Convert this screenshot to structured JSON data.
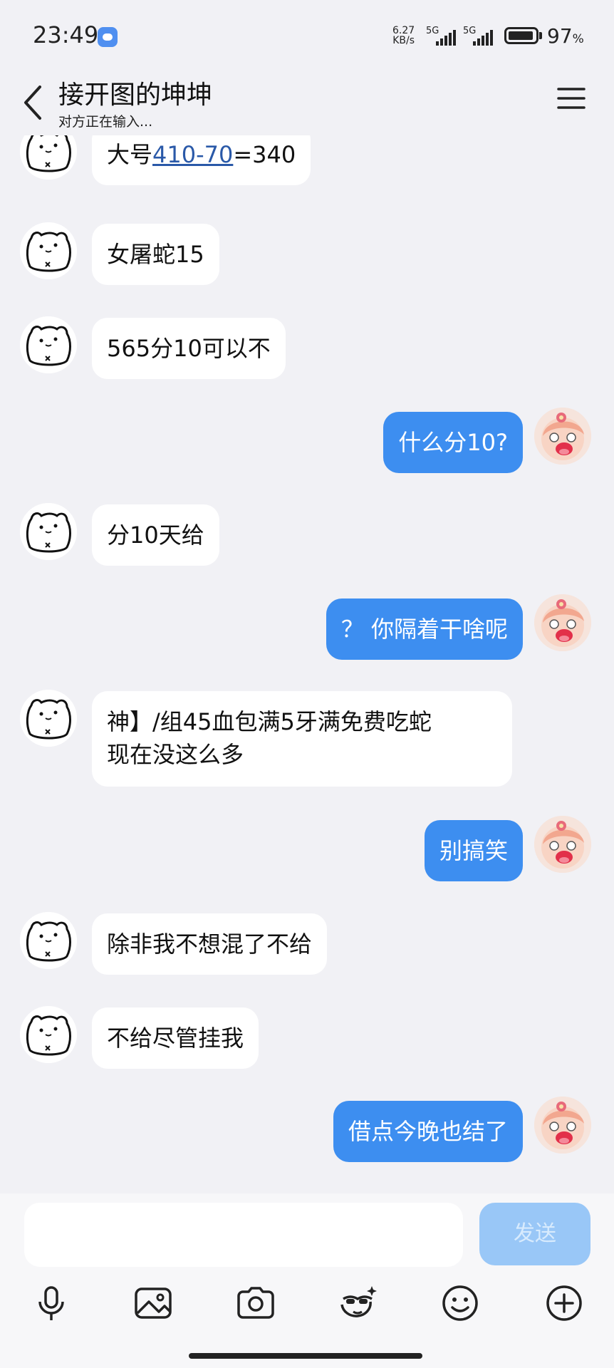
{
  "status_bar": {
    "time": "23:49",
    "net_speed_value": "6.27",
    "net_speed_unit": "KB/s",
    "sim1": "5G",
    "sim2": "5G",
    "battery": "97",
    "battery_unit": "%"
  },
  "header": {
    "title": "接开图的坤坤",
    "subtitle": "对方正在输入..."
  },
  "messages": [
    {
      "side": "in",
      "parts": [
        "大号",
        "410-70",
        "=340"
      ]
    },
    {
      "side": "in",
      "text": "女屠蛇15"
    },
    {
      "side": "in",
      "text": "565分10可以不"
    },
    {
      "side": "out",
      "text": "什么分10?"
    },
    {
      "side": "in",
      "text": "分10天给"
    },
    {
      "side": "out",
      "text": "？ 你隔着干啥呢"
    },
    {
      "side": "in",
      "lines": [
        "神】/组45血包满5牙满免费吃蛇",
        "现在没这么多"
      ]
    },
    {
      "side": "out",
      "text": "别搞笑"
    },
    {
      "side": "in",
      "text": "除非我不想混了不给"
    },
    {
      "side": "in",
      "text": "不给尽管挂我"
    },
    {
      "side": "out",
      "text": "借点今晚也结了"
    }
  ],
  "composer": {
    "input_value": "",
    "send_label": "发送"
  },
  "toolbar": [
    "microphone-icon",
    "image-icon",
    "camera-icon",
    "sticker-icon",
    "emoji-icon",
    "plus-icon"
  ],
  "colors": {
    "background": "#f1f1f5",
    "outgoing_bubble": "#3d8ef0",
    "incoming_bubble": "#ffffff",
    "send_button": "#99c7f7",
    "link": "#2a59a8"
  }
}
